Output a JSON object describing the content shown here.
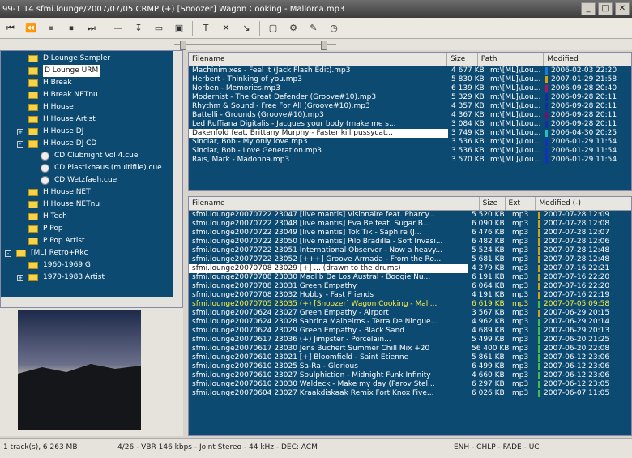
{
  "window": {
    "title": "99-1 14 sfmi.lounge/2007/07/05 CRMP (+) [Snoozer] Wagon Cooking - Mallorca.mp3",
    "controls": [
      "_",
      "□",
      "✕"
    ]
  },
  "toolbar": {
    "buttons": [
      {
        "icon": "prev-track-icon",
        "glyph": "⏮"
      },
      {
        "icon": "rewind-icon",
        "glyph": "⏪"
      },
      {
        "icon": "pause-icon",
        "glyph": "⏸"
      },
      {
        "icon": "stop-icon",
        "glyph": "⏹"
      },
      {
        "icon": "next-track-icon",
        "glyph": "⏭"
      },
      {
        "icon": "dash-icon",
        "glyph": "—"
      },
      {
        "icon": "filter-icon",
        "glyph": "↧"
      },
      {
        "icon": "window-icon",
        "glyph": "▭"
      },
      {
        "icon": "screen-icon",
        "glyph": "▣"
      },
      {
        "icon": "text-icon",
        "glyph": "T"
      },
      {
        "icon": "close-icon",
        "glyph": "✕"
      },
      {
        "icon": "sort-icon",
        "glyph": "↘"
      },
      {
        "icon": "frame-icon",
        "glyph": "▢"
      },
      {
        "icon": "gear-icon",
        "glyph": "⚙"
      },
      {
        "icon": "tools-icon",
        "glyph": "✎"
      },
      {
        "icon": "clock-icon",
        "glyph": "◷"
      }
    ]
  },
  "seek": {
    "position": 0.05,
    "volume": 0.92
  },
  "tree": {
    "items": [
      {
        "label": "D Lounge Sampler",
        "kind": "folder",
        "indent": 2
      },
      {
        "label": "D Lounge URM",
        "kind": "folder",
        "indent": 2,
        "selected": true
      },
      {
        "label": "H Break",
        "kind": "folder",
        "indent": 2
      },
      {
        "label": "H Break NETnu",
        "kind": "folder",
        "indent": 2
      },
      {
        "label": "H House",
        "kind": "folder",
        "indent": 2
      },
      {
        "label": "H House Artist",
        "kind": "folder",
        "indent": 2
      },
      {
        "label": "H House DJ",
        "kind": "folder",
        "indent": 2,
        "expander": "+"
      },
      {
        "label": "H House DJ CD",
        "kind": "folder",
        "indent": 2,
        "expander": "-"
      },
      {
        "label": "CD Clubnight Vol 4.cue",
        "kind": "cd",
        "indent": 3
      },
      {
        "label": "CD Plastikhaus (multifile).cue",
        "kind": "cd",
        "indent": 3
      },
      {
        "label": "CD Wetzfaeh.cue",
        "kind": "cd",
        "indent": 3
      },
      {
        "label": "H House NET",
        "kind": "folder",
        "indent": 2
      },
      {
        "label": "H House NETnu",
        "kind": "folder",
        "indent": 2
      },
      {
        "label": "H Tech",
        "kind": "folder",
        "indent": 2
      },
      {
        "label": "P Pop",
        "kind": "folder",
        "indent": 2
      },
      {
        "label": "P Pop Artist",
        "kind": "folder",
        "indent": 2
      },
      {
        "label": "[ML] Retro+Rkc",
        "kind": "folder",
        "indent": 1,
        "expander": "-"
      },
      {
        "label": "1960-1969 G",
        "kind": "folder",
        "indent": 2
      },
      {
        "label": "1970-1983 Artist",
        "kind": "folder",
        "indent": 2,
        "expander": "+"
      }
    ]
  },
  "top_list": {
    "headers": [
      "Filename",
      "Size",
      "Path",
      "Modified"
    ],
    "rows": [
      {
        "name": "Machinimixes - Feel It (Jack Flash Edit).mp3",
        "size": "4 677 KB",
        "path": "m:\\[ML]\\Lou...",
        "modified": "2006-02-03 22:20",
        "bar": "#1a7bd0"
      },
      {
        "name": "Herbert - Thinking of you.mp3",
        "size": "5 830 KB",
        "path": "m:\\[ML]\\Lou...",
        "modified": "2007-01-29 21:58",
        "bar": "#d4a010"
      },
      {
        "name": "Norben - Memories.mp3",
        "size": "6 139 KB",
        "path": "m:\\[ML]\\Lou...",
        "modified": "2006-09-28 20:40",
        "bar": "#b01070"
      },
      {
        "name": "Modernist - The Great Defender (Groove#10).mp3",
        "size": "5 329 KB",
        "path": "m:\\[ML]\\Lou...",
        "modified": "2006-09-28 20:11",
        "bar": "#1030a0"
      },
      {
        "name": "Rhythm & Sound - Free For All (Groove#10).mp3",
        "size": "4 357 KB",
        "path": "m:\\[ML]\\Lou...",
        "modified": "2006-09-28 20:11",
        "bar": "#1030a0"
      },
      {
        "name": "Battelli - Grounds (Groove#10).mp3",
        "size": "4 367 KB",
        "path": "m:\\[ML]\\Lou...",
        "modified": "2006-09-28 20:11",
        "bar": "#701070"
      },
      {
        "name": "Led Ruffiana Digitalis - Jacques your body (make me s...",
        "size": "3 084 KB",
        "path": "m:\\[ML]\\Lou...",
        "modified": "2006-09-28 20:11",
        "bar": "#1030a0"
      },
      {
        "name": "Dakenfold feat. Brittany Murphy - Faster kill pussycat...",
        "size": "3 749 KB",
        "path": "m:\\[ML]\\Lou...",
        "modified": "2006-04-30 20:25",
        "bar": "#20c0c0",
        "selected": true
      },
      {
        "name": "Sinclar, Bob - My only love.mp3",
        "size": "3 536 KB",
        "path": "m:\\[ML]\\Lou...",
        "modified": "2006-01-29 11:54",
        "bar": "#1030c0"
      },
      {
        "name": "Sinclar, Bob - Love Generation.mp3",
        "size": "3 536 KB",
        "path": "m:\\[ML]\\Lou...",
        "modified": "2006-01-29 11:54",
        "bar": "#1030c0"
      },
      {
        "name": "Rais, Mark - Madonna.mp3",
        "size": "3 570 KB",
        "path": "m:\\[ML]\\Lou...",
        "modified": "2006-01-29 11:54",
        "bar": "#1030c0"
      }
    ]
  },
  "bottom_list": {
    "headers": [
      "Filename",
      "Size",
      "Ext",
      "Modified (-)"
    ],
    "rows": [
      {
        "name": "sfmi.lounge20070722 23047 [live mantis] Visionaire feat. Pharcy...",
        "size": "5 520 KB",
        "ext": "mp3",
        "modified": "2007-07-28 12:09",
        "bar": "#d4a010"
      },
      {
        "name": "sfmi.lounge20070722 23048 [live mantis] Eva Be feat. Sugar B...",
        "size": "6 090 KB",
        "ext": "mp3",
        "modified": "2007-07-28 12:08",
        "bar": "#d4a010"
      },
      {
        "name": "sfmi.lounge20070722 23049 [live mantis] Tok Tik - Saphire (J...",
        "size": "6 476 KB",
        "ext": "mp3",
        "modified": "2007-07-28 12:07",
        "bar": "#d4a010"
      },
      {
        "name": "sfmi.lounge20070722 23050 [live mantis] Pilo Bradilla - Soft Invasi...",
        "size": "6 482 KB",
        "ext": "mp3",
        "modified": "2007-07-28 12:06",
        "bar": "#d4a010"
      },
      {
        "name": "sfmi.lounge20070722 23051 International Observer - Now a heavy...",
        "size": "5 524 KB",
        "ext": "mp3",
        "modified": "2007-07-28 12:48",
        "bar": "#d4a010"
      },
      {
        "name": "sfmi.lounge20070722 23052 [+++] Groove Armada - From the Ro...",
        "size": "5 681 KB",
        "ext": "mp3",
        "modified": "2007-07-28 12:48",
        "bar": "#d4a010"
      },
      {
        "name": "sfmi.lounge20070708 23029 [+] ... (drawn to the drums)",
        "size": "4 279 KB",
        "ext": "mp3",
        "modified": "2007-07-16 22:21",
        "bar": "#d4a010",
        "selected": true
      },
      {
        "name": "sfmi.lounge20070708 23030 Madlib De Los Austral - Boogie Nu...",
        "size": "6 191 KB",
        "ext": "mp3",
        "modified": "2007-07-16 22:20",
        "bar": "#d4a010"
      },
      {
        "name": "sfmi.lounge20070708 23031 Green Empathy",
        "size": "6 064 KB",
        "ext": "mp3",
        "modified": "2007-07-16 22:20",
        "bar": "#d4a010"
      },
      {
        "name": "sfmi.lounge20070708 23032 Hobby - Fast Friends",
        "size": "4 191 KB",
        "ext": "mp3",
        "modified": "2007-07-16 22:19",
        "bar": "#d4a010"
      },
      {
        "name": "sfmi.lounge20070705 23035 (+) [Snoozer] Wagon Cooking - Mall...",
        "size": "6 619 KB",
        "ext": "mp3",
        "modified": "2007-07-05 09:58",
        "bar": "#40c040",
        "playing": true
      },
      {
        "name": "sfmi.lounge20070624 23027 Green Empathy - Airport",
        "size": "3 567 KB",
        "ext": "mp3",
        "modified": "2007-06-29 20:15",
        "bar": "#d4a010"
      },
      {
        "name": "sfmi.lounge20070624 23028 Sabrina Malheiros - Terra De Ningue...",
        "size": "4 962 KB",
        "ext": "mp3",
        "modified": "2007-06-29 20:14",
        "bar": "#40c040"
      },
      {
        "name": "sfmi.lounge20070624 23029 Green Empathy - Black Sand",
        "size": "4 689 KB",
        "ext": "mp3",
        "modified": "2007-06-29 20:13",
        "bar": "#40c040"
      },
      {
        "name": "sfmi.lounge20070617 23036 (+) Jimpster - Porcelain...",
        "size": "5 499 KB",
        "ext": "mp3",
        "modified": "2007-06-20 21:25",
        "bar": "#40c040"
      },
      {
        "name": "sfmi.lounge20070617 23030 Jens Buchert Summer Chill Mix +20",
        "size": "56 400 KB",
        "ext": "mp3",
        "modified": "2007-06-20 22:08",
        "bar": "#40c040"
      },
      {
        "name": "sfmi.lounge20070610 23021 [+] Bloomfield - Saint Etienne",
        "size": "5 861 KB",
        "ext": "mp3",
        "modified": "2007-06-12 23:06",
        "bar": "#40c040"
      },
      {
        "name": "sfmi.lounge20070610 23025 Sa-Ra - Glorious",
        "size": "6 499 KB",
        "ext": "mp3",
        "modified": "2007-06-12 23:06",
        "bar": "#40c040"
      },
      {
        "name": "sfmi.lounge20070610 23027 Soulphiction - Midnight Funk Infinity",
        "size": "4 660 KB",
        "ext": "mp3",
        "modified": "2007-06-12 23:06",
        "bar": "#40c040"
      },
      {
        "name": "sfmi.lounge20070610 23030 Waldeck - Make my day (Parov Stel...",
        "size": "6 297 KB",
        "ext": "mp3",
        "modified": "2007-06-12 23:05",
        "bar": "#40c040"
      },
      {
        "name": "sfmi.lounge20070604 23027 Kraakdiskaak Remix Fort Knox Five...",
        "size": "6 026 KB",
        "ext": "mp3",
        "modified": "2007-06-07 11:05",
        "bar": "#40c040"
      }
    ]
  },
  "status": {
    "left": "1 track(s), 6 263 MB",
    "middle": "4/26 - VBR 146 kbps - Joint Stereo - 44 kHz - DEC: ACM",
    "right": "ENH - CHLP - FADE - UC"
  },
  "colors": {
    "panel_bg": "#0d4a72",
    "selection": "#ffffff",
    "playing": "#ffee44"
  }
}
